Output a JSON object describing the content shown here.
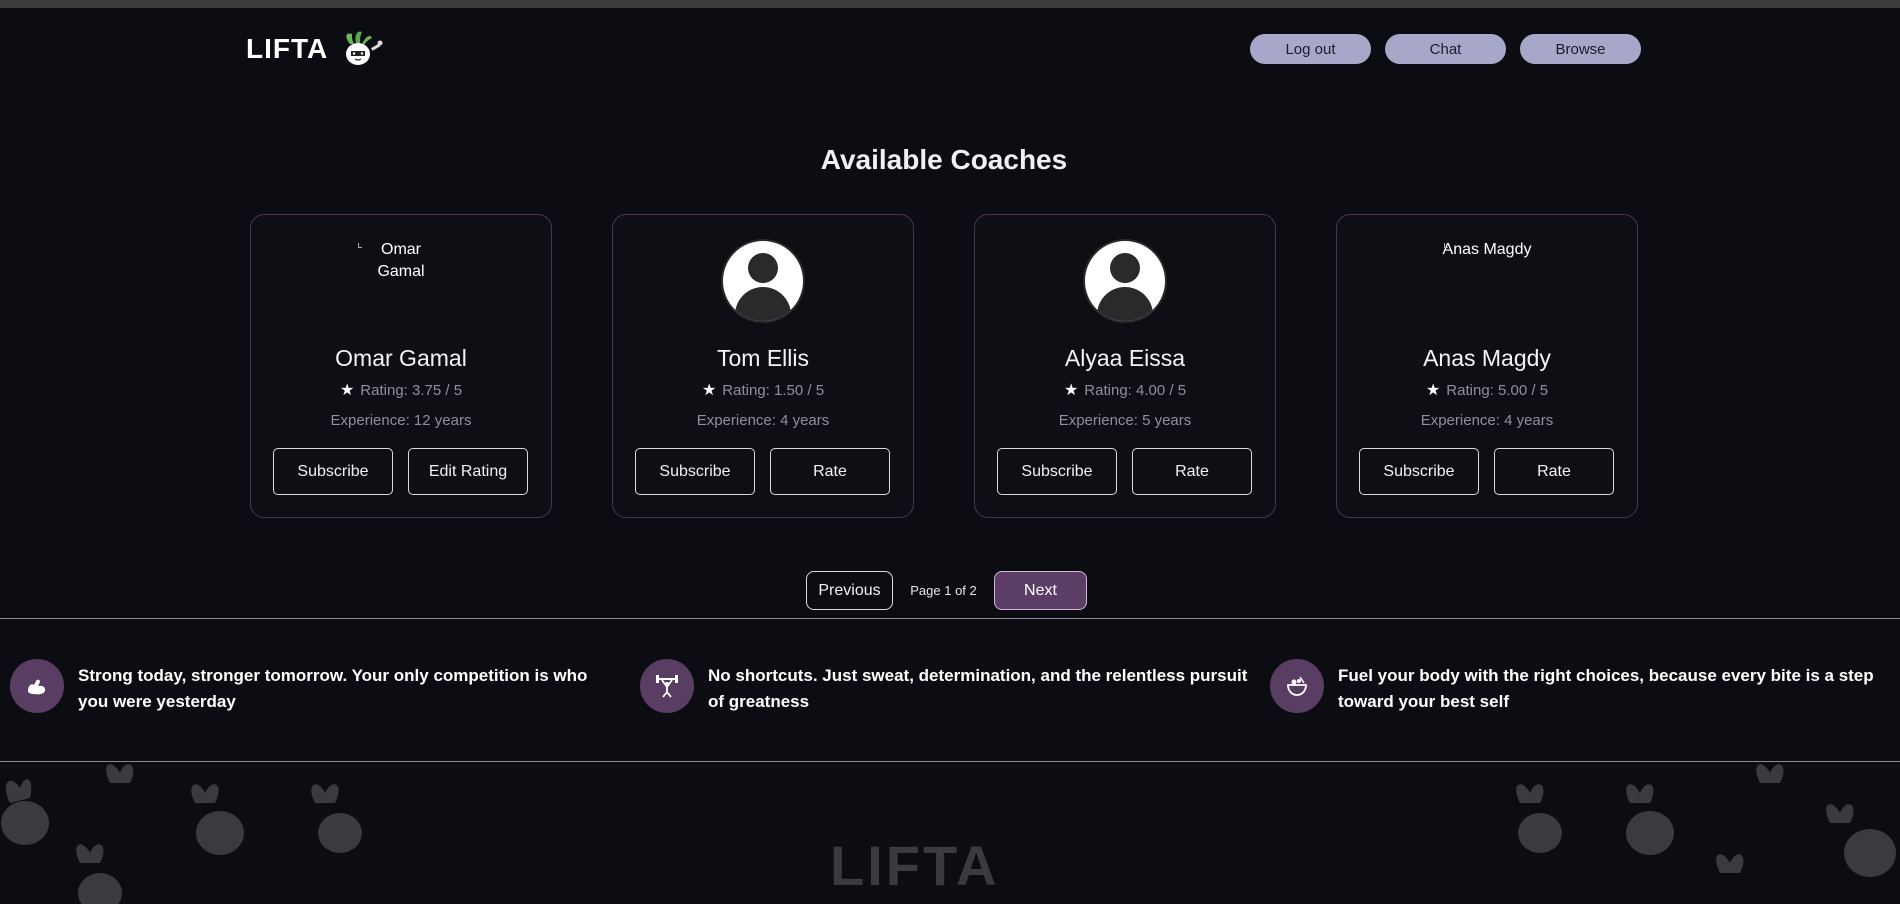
{
  "header": {
    "logo_text": "LIFTA",
    "nav": [
      {
        "label": "Log out"
      },
      {
        "label": "Chat"
      },
      {
        "label": "Browse"
      }
    ]
  },
  "page_title": "Available Coaches",
  "coaches": [
    {
      "name": "Omar Gamal",
      "avatar_alt": "Omar Gamal",
      "avatar": "broken-image",
      "rating": "Rating: 3.75 / 5",
      "experience": "Experience: 12 years",
      "primary_action": "Subscribe",
      "secondary_action": "Edit Rating"
    },
    {
      "name": "Tom Ellis",
      "avatar": "default-user-icon",
      "rating": "Rating: 1.50 / 5",
      "experience": "Experience: 4 years",
      "primary_action": "Subscribe",
      "secondary_action": "Rate"
    },
    {
      "name": "Alyaa Eissa",
      "avatar": "default-user-icon",
      "rating": "Rating: 4.00 / 5",
      "experience": "Experience: 5 years",
      "primary_action": "Subscribe",
      "secondary_action": "Rate"
    },
    {
      "name": "Anas Magdy",
      "avatar_alt": "Anas Magdy",
      "avatar": "broken-image",
      "rating": "Rating: 5.00 / 5",
      "experience": "Experience: 4 years",
      "primary_action": "Subscribe",
      "secondary_action": "Rate"
    }
  ],
  "pagination": {
    "previous_label": "Previous",
    "page_info": "Page 1 of 2",
    "next_label": "Next"
  },
  "quotes": [
    {
      "icon": "flexed-arm-icon",
      "text": "Strong today, stronger tomorrow. Your only competition is who you were yesterday"
    },
    {
      "icon": "weightlifter-icon",
      "text": "No shortcuts. Just sweat, determination, and the relentless pursuit of greatness"
    },
    {
      "icon": "food-bowl-icon",
      "text": "Fuel your body with the right choices, because every bite is a step toward your best self"
    }
  ],
  "footer": {
    "brand_text": "LIFTA"
  },
  "colors": {
    "background": "#0c0d12",
    "nav_button": "#a6a7c9",
    "accent_purple": "#5c3d66",
    "card_border": "#4b3552",
    "muted_text": "#8f8f99"
  }
}
